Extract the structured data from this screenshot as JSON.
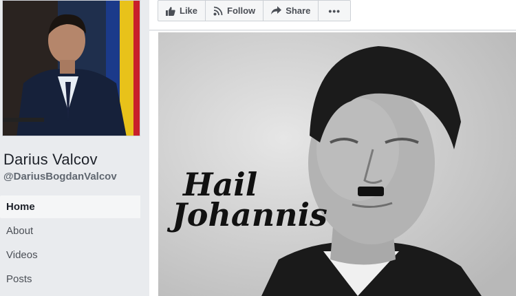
{
  "profile": {
    "name": "Darius Valcov",
    "handle": "@DariusBogdanValcov",
    "photo_alt_icon": "profile-photo"
  },
  "nav": {
    "items": [
      {
        "label": "Home",
        "active": true
      },
      {
        "label": "About",
        "active": false
      },
      {
        "label": "Videos",
        "active": false
      },
      {
        "label": "Posts",
        "active": false
      }
    ]
  },
  "toolbar": {
    "like_label": "Like",
    "follow_label": "Follow",
    "share_label": "Share",
    "more_label": "•••",
    "icons": [
      "thumbs-up-icon",
      "rss-icon",
      "share-arrow-icon"
    ]
  },
  "post": {
    "caption_line1": "Hail",
    "caption_line2": "Johannis"
  },
  "colors": {
    "page_bg": "#e9ebee",
    "text": "#1d2129",
    "muted": "#606770",
    "button_bg": "#f5f6f7",
    "border": "#ccd0d5"
  }
}
